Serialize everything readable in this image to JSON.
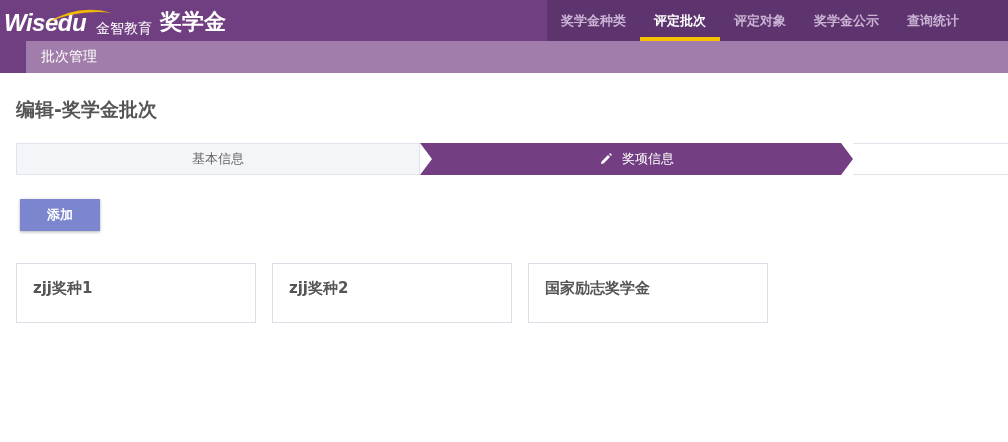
{
  "header": {
    "logo": "Wisedu",
    "logo_subtitle": "金智教育",
    "title": "奖学金"
  },
  "nav": [
    {
      "label": "奖学金种类",
      "selected": false
    },
    {
      "label": "评定批次",
      "selected": true
    },
    {
      "label": "评定对象",
      "selected": false
    },
    {
      "label": "奖学金公示",
      "selected": false
    },
    {
      "label": "查询统计",
      "selected": false
    }
  ],
  "breadcrumb": "批次管理",
  "page_title": "编辑-奖学金批次",
  "steps": [
    {
      "label": "基本信息",
      "selected": false
    },
    {
      "label": "奖项信息",
      "selected": true
    }
  ],
  "add_button": "添加",
  "cards": [
    {
      "title": "zjj奖种1"
    },
    {
      "title": "zjj奖种2"
    },
    {
      "title": "国家励志奖学金"
    }
  ]
}
